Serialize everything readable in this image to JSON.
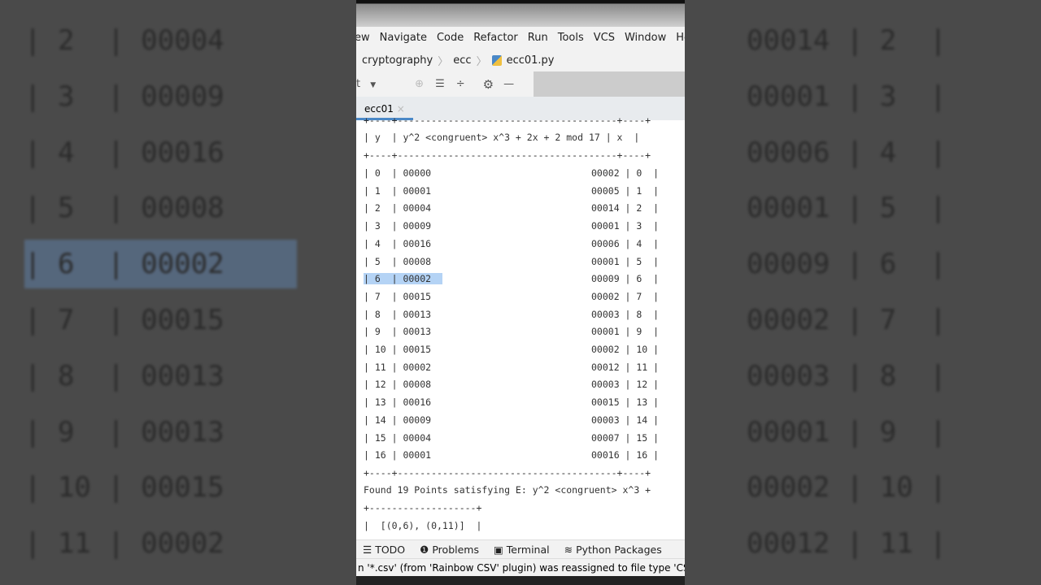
{
  "menu": [
    "ew",
    "Navigate",
    "Code",
    "Refactor",
    "Run",
    "Tools",
    "VCS",
    "Window",
    "Help"
  ],
  "breadcrumbs": [
    "cryptography",
    "ecc",
    "ecc01.py"
  ],
  "toolbar": {
    "config_label": "t"
  },
  "run_tab": "ecc01",
  "table": {
    "border": "+----+---------------------------------------+----+",
    "header": "| y  | y^2 <congruent> x^3 + 2x + 2 mod 17 | x  |",
    "rows": [
      [
        "0",
        "00000",
        "00002",
        "0"
      ],
      [
        "1",
        "00001",
        "00005",
        "1"
      ],
      [
        "2",
        "00004",
        "00014",
        "2"
      ],
      [
        "3",
        "00009",
        "00001",
        "3"
      ],
      [
        "4",
        "00016",
        "00006",
        "4"
      ],
      [
        "5",
        "00008",
        "00001",
        "5"
      ],
      [
        "6",
        "00002",
        "00009",
        "6"
      ],
      [
        "7",
        "00015",
        "00002",
        "7"
      ],
      [
        "8",
        "00013",
        "00003",
        "8"
      ],
      [
        "9",
        "00013",
        "00001",
        "9"
      ],
      [
        "10",
        "00015",
        "00002",
        "10"
      ],
      [
        "11",
        "00002",
        "00012",
        "11"
      ],
      [
        "12",
        "00008",
        "00003",
        "12"
      ],
      [
        "13",
        "00016",
        "00015",
        "13"
      ],
      [
        "14",
        "00009",
        "00003",
        "14"
      ],
      [
        "15",
        "00004",
        "00007",
        "15"
      ],
      [
        "16",
        "00001",
        "00016",
        "16"
      ]
    ],
    "selected_row": 6
  },
  "found_text": "Found 19 Points satisfying E: y^2 <congruent> x^3 +",
  "points_border": "+-------------------+",
  "points_line": "|  [(0,6), (0,11)]  |",
  "bottom_tabs": [
    "TODO",
    "Problems",
    "Terminal",
    "Python Packages"
  ],
  "status": "n '*.csv' (from 'Rainbow CSV' plugin) was reassigned to file type 'CSV' by"
}
